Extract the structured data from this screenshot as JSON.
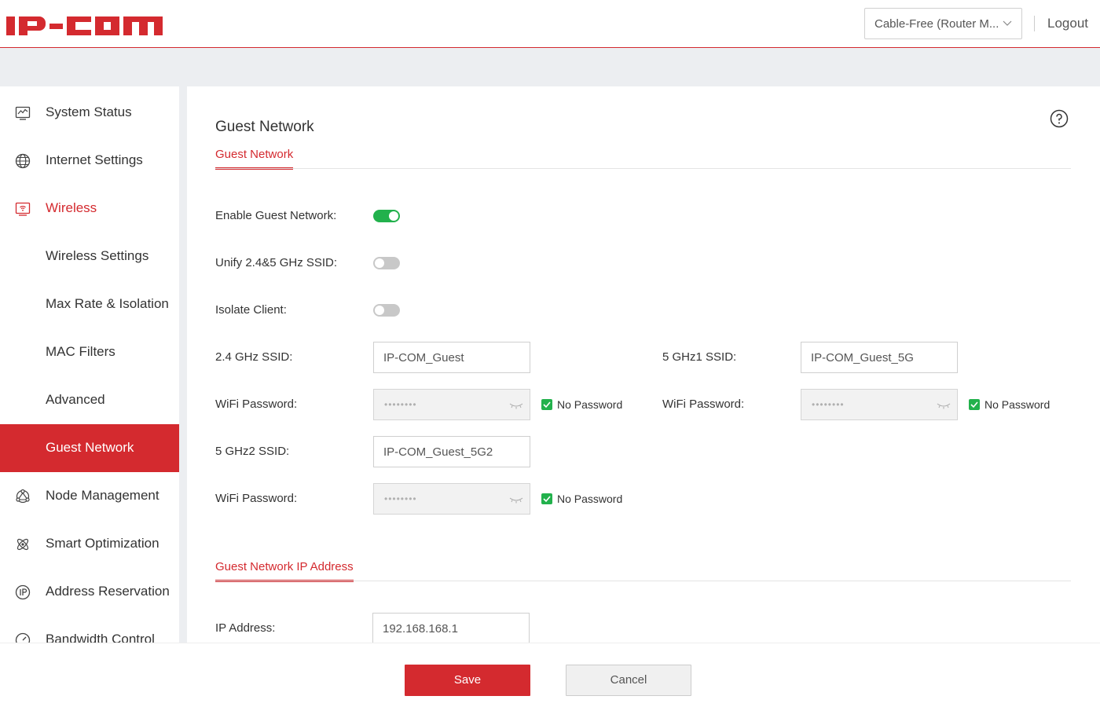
{
  "header": {
    "logo_text": "IP-COM",
    "mode_select_value": "Cable-Free (Router M...",
    "logout_label": "Logout"
  },
  "colors": {
    "brand_red": "#d42a2f",
    "toggle_on": "#22b14c",
    "toggle_off": "#c8c8c8",
    "checkbox": "#22b14c"
  },
  "sidebar": {
    "items": [
      {
        "label": "System Status",
        "icon": "chart-monitor-icon"
      },
      {
        "label": "Internet Settings",
        "icon": "globe-icon"
      },
      {
        "label": "Wireless",
        "icon": "wifi-monitor-icon",
        "state": "expanded"
      },
      {
        "label": "Wireless Settings"
      },
      {
        "label": "Max Rate & Isolation"
      },
      {
        "label": "MAC Filters"
      },
      {
        "label": "Advanced"
      },
      {
        "label": "Guest Network",
        "state": "active"
      },
      {
        "label": "Node Management",
        "icon": "node-network-icon"
      },
      {
        "label": "Smart Optimization",
        "icon": "atom-icon"
      },
      {
        "label": "Address Reservation",
        "icon": "ip-icon"
      },
      {
        "label": "Bandwidth Control",
        "icon": "speedometer-icon"
      }
    ]
  },
  "main": {
    "page_title": "Guest Network",
    "section1_tab": "Guest Network",
    "enable_guest_label": "Enable Guest Network:",
    "enable_guest_on": true,
    "unify_label": "Unify 2.4&5 GHz SSID:",
    "unify_on": false,
    "isolate_label": "Isolate Client:",
    "isolate_on": false,
    "ssid24_label": "2.4 GHz SSID:",
    "ssid24_value": "IP-COM_Guest",
    "ssid5g1_label": "5 GHz1 SSID:",
    "ssid5g1_value": "IP-COM_Guest_5G",
    "ssid5g2_label": "5 GHz2 SSID:",
    "ssid5g2_value": "IP-COM_Guest_5G2",
    "wifi_password_label": "WiFi Password:",
    "password_mask": "••••••••",
    "no_password_label": "No Password",
    "section2_tab": "Guest Network IP Address",
    "ip_label": "IP Address:",
    "ip_value": "192.168.168.1"
  },
  "footer": {
    "save_label": "Save",
    "cancel_label": "Cancel"
  }
}
